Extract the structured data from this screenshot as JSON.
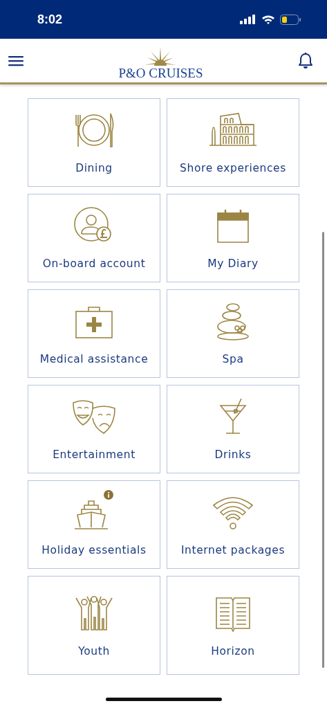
{
  "status_bar": {
    "time": "8:02"
  },
  "header": {
    "logo_text": "P&O CRUISES"
  },
  "tiles": [
    {
      "label": "Dining",
      "kind": "dining",
      "info_badge": false
    },
    {
      "label": "Shore experiences",
      "kind": "colosseum",
      "info_badge": false
    },
    {
      "label": "On-board account",
      "kind": "account",
      "info_badge": false
    },
    {
      "label": "My Diary",
      "kind": "calendar",
      "info_badge": false
    },
    {
      "label": "Medical assistance",
      "kind": "medical",
      "info_badge": false
    },
    {
      "label": "Spa",
      "kind": "spa",
      "info_badge": false
    },
    {
      "label": "Entertainment",
      "kind": "masks",
      "info_badge": false
    },
    {
      "label": "Drinks",
      "kind": "cocktail",
      "info_badge": false
    },
    {
      "label": "Holiday essentials",
      "kind": "ship",
      "info_badge": true
    },
    {
      "label": "Internet packages",
      "kind": "wifi",
      "info_badge": false
    },
    {
      "label": "Youth",
      "kind": "people",
      "info_badge": false
    },
    {
      "label": "Horizon",
      "kind": "book",
      "info_badge": false
    }
  ]
}
